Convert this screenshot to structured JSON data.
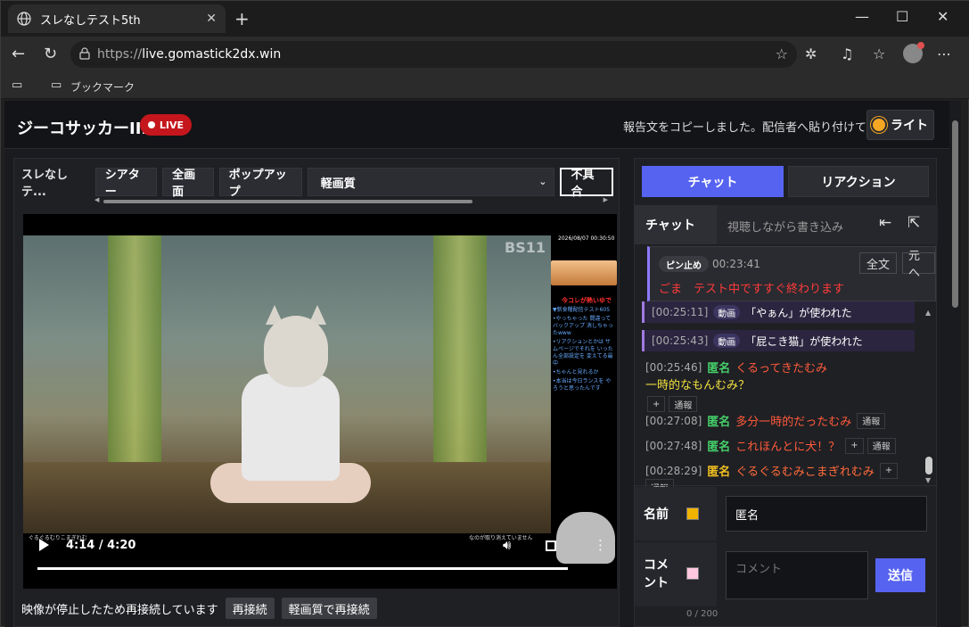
{
  "browser": {
    "tab_title": "スレなしテスト5th",
    "url_prefix": "https://",
    "url_host": "live.gomastick2dx.win",
    "bookmarks_label": "ブックマーク"
  },
  "header": {
    "site_title": "ジーコサッカーIIDX",
    "live_label": "LIVE",
    "notice": "報告文をコピーしました。配信者へ貼り付けてください",
    "light_button": "ライト"
  },
  "player_controls": {
    "channel_label": "スレなしテ...",
    "buttons": [
      "シアター",
      "全画面",
      "ポップアップ"
    ],
    "quality_selected": "軽画質",
    "report_button": "不具合"
  },
  "video": {
    "time": "4:14 / 4:20",
    "progress_fraction": 0.976,
    "broadcaster_logo": "BS11",
    "overlay_timestamp": "2026/08/07 00:30:50",
    "overlay_title": "今コレが熱いゆで",
    "overlay_lines": [
      "▼新食糧配信テスト605",
      "•やっちゃった 間違ってバックアップ 消しちゃったwww",
      "•リアクションとかは サムページでそれを いったん全部設定を 変えてる最中",
      "•ちゃんと見れるか",
      "•本当は今日ランスを やろうと思ったんです"
    ],
    "caption_left": "ぐるぐるむりこまぎれむ",
    "caption_right": "なのが取り消えていません"
  },
  "reconnect": {
    "message": "映像が停止したため再接続しています",
    "btn_reconnect": "再接続",
    "btn_light_reconnect": "軽画質で再接続"
  },
  "chat": {
    "tab_chat": "チャット",
    "tab_reaction": "リアクション",
    "section_label": "チャット",
    "placeholder": "視聴しながら書き込み",
    "pinned": {
      "tag": "ピン止め",
      "time": "00:23:41",
      "btn_full": "全文",
      "btn_back": "元へ",
      "message": "ごま　テスト中ですすぐ終わります"
    },
    "system_messages": [
      {
        "time": "[00:25:11]",
        "tag": "動画",
        "text": "「やぁん」が使われた"
      },
      {
        "time": "[00:25:43]",
        "tag": "動画",
        "text": "「屁こき猫」が使われた"
      }
    ],
    "messages": [
      {
        "time": "[00:25:46]",
        "name": "匿名",
        "text1": "くるってきたむみ",
        "text2": "一時的なもんむみ？",
        "plus": "+",
        "report": "通報"
      },
      {
        "time": "[00:27:08]",
        "name": "匿名",
        "text1": "多分一時的だったむみ",
        "report": "通報"
      },
      {
        "time": "[00:27:48]",
        "name": "匿名",
        "text1": "これほんとに犬！？",
        "plus": "+",
        "report": "通報"
      },
      {
        "time": "[00:28:29]",
        "name": "匿名",
        "text1": "ぐるぐるむみこまぎれむみ",
        "plus": "+",
        "report": "通報"
      }
    ]
  },
  "form": {
    "name_label": "名前",
    "name_value": "匿名",
    "name_color": "#f0b400",
    "comment_label": "コメ\nント",
    "comment_placeholder": "コメント",
    "comment_color": "#ffc8e0",
    "send_button": "送信",
    "counter": "0 / 200"
  },
  "colors": {
    "accent": "#5663f0",
    "live": "#c4161c",
    "pinned_text": "#ff3a3a"
  }
}
